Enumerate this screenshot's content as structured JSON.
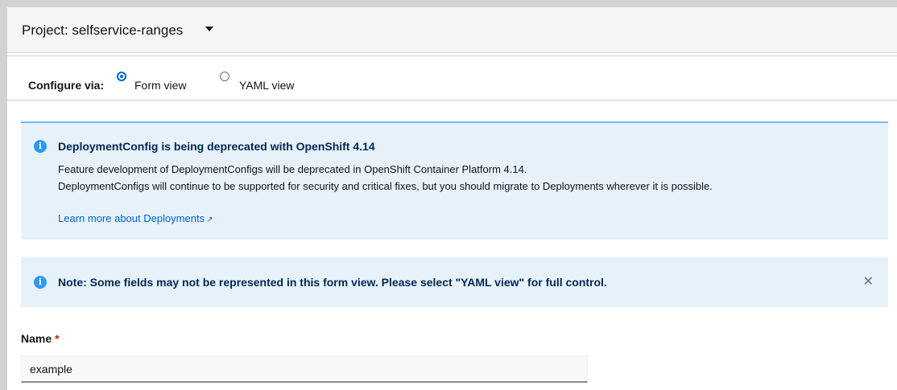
{
  "project": {
    "label": "Project: selfservice-ranges"
  },
  "configure": {
    "label": "Configure via:",
    "options": [
      {
        "label": "Form view",
        "selected": true
      },
      {
        "label": "YAML view",
        "selected": false
      }
    ]
  },
  "alerts": {
    "deprecation": {
      "title": "DeploymentConfig is being deprecated with OpenShift 4.14",
      "line1": "Feature development of DeploymentConfigs will be deprecated in OpenShift Container Platform 4.14.",
      "line2": "DeploymentConfigs will continue to be supported for security and critical fixes, but you should migrate to Deployments wherever it is possible.",
      "link": "Learn more about Deployments",
      "icon": "info-icon",
      "link_icon": "external-link-icon"
    },
    "note": {
      "title": "Note: Some fields may not be represented in this form view. Please select \"YAML view\" for full control.",
      "icon": "info-icon",
      "close_icon": "close-icon"
    }
  },
  "form": {
    "name_label": "Name",
    "required_mark": "*",
    "name_value": "example"
  },
  "colors": {
    "accent": "#0066cc",
    "info": "#2b9af3",
    "alert_bg": "#e7f1fa",
    "required": "#c9190b"
  }
}
